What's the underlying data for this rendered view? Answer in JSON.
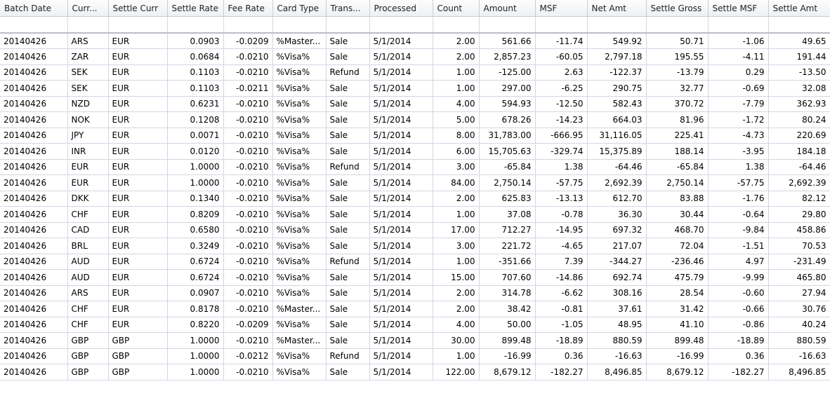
{
  "columns": [
    {
      "label": "Batch Date",
      "align": "txt"
    },
    {
      "label": "Curr...",
      "align": "txt"
    },
    {
      "label": "Settle Curr",
      "align": "txt"
    },
    {
      "label": "Settle Rate",
      "align": "num"
    },
    {
      "label": "Fee Rate",
      "align": "num"
    },
    {
      "label": "Card Type",
      "align": "txt"
    },
    {
      "label": "Trans...",
      "align": "txt"
    },
    {
      "label": "Processed",
      "align": "txt"
    },
    {
      "label": "Count",
      "align": "num"
    },
    {
      "label": "Amount",
      "align": "num"
    },
    {
      "label": "MSF",
      "align": "num"
    },
    {
      "label": "Net Amt",
      "align": "num"
    },
    {
      "label": "Settle Gross",
      "align": "num"
    },
    {
      "label": "Settle MSF",
      "align": "num"
    },
    {
      "label": "Settle Amt",
      "align": "num"
    }
  ],
  "rows": [
    [
      "20140426",
      "ARS",
      "EUR",
      "0.0903",
      "-0.0209",
      "%Master...",
      "Sale",
      "5/1/2014",
      "2.00",
      "561.66",
      "-11.74",
      "549.92",
      "50.71",
      "-1.06",
      "49.65"
    ],
    [
      "20140426",
      "ZAR",
      "EUR",
      "0.0684",
      "-0.0210",
      "%Visa%",
      "Sale",
      "5/1/2014",
      "2.00",
      "2,857.23",
      "-60.05",
      "2,797.18",
      "195.55",
      "-4.11",
      "191.44"
    ],
    [
      "20140426",
      "SEK",
      "EUR",
      "0.1103",
      "-0.0210",
      "%Visa%",
      "Refund",
      "5/1/2014",
      "1.00",
      "-125.00",
      "2.63",
      "-122.37",
      "-13.79",
      "0.29",
      "-13.50"
    ],
    [
      "20140426",
      "SEK",
      "EUR",
      "0.1103",
      "-0.0211",
      "%Visa%",
      "Sale",
      "5/1/2014",
      "1.00",
      "297.00",
      "-6.25",
      "290.75",
      "32.77",
      "-0.69",
      "32.08"
    ],
    [
      "20140426",
      "NZD",
      "EUR",
      "0.6231",
      "-0.0210",
      "%Visa%",
      "Sale",
      "5/1/2014",
      "4.00",
      "594.93",
      "-12.50",
      "582.43",
      "370.72",
      "-7.79",
      "362.93"
    ],
    [
      "20140426",
      "NOK",
      "EUR",
      "0.1208",
      "-0.0210",
      "%Visa%",
      "Sale",
      "5/1/2014",
      "5.00",
      "678.26",
      "-14.23",
      "664.03",
      "81.96",
      "-1.72",
      "80.24"
    ],
    [
      "20140426",
      "JPY",
      "EUR",
      "0.0071",
      "-0.0210",
      "%Visa%",
      "Sale",
      "5/1/2014",
      "8.00",
      "31,783.00",
      "-666.95",
      "31,116.05",
      "225.41",
      "-4.73",
      "220.69"
    ],
    [
      "20140426",
      "INR",
      "EUR",
      "0.0120",
      "-0.0210",
      "%Visa%",
      "Sale",
      "5/1/2014",
      "6.00",
      "15,705.63",
      "-329.74",
      "15,375.89",
      "188.14",
      "-3.95",
      "184.18"
    ],
    [
      "20140426",
      "EUR",
      "EUR",
      "1.0000",
      "-0.0210",
      "%Visa%",
      "Refund",
      "5/1/2014",
      "3.00",
      "-65.84",
      "1.38",
      "-64.46",
      "-65.84",
      "1.38",
      "-64.46"
    ],
    [
      "20140426",
      "EUR",
      "EUR",
      "1.0000",
      "-0.0210",
      "%Visa%",
      "Sale",
      "5/1/2014",
      "84.00",
      "2,750.14",
      "-57.75",
      "2,692.39",
      "2,750.14",
      "-57.75",
      "2,692.39"
    ],
    [
      "20140426",
      "DKK",
      "EUR",
      "0.1340",
      "-0.0210",
      "%Visa%",
      "Sale",
      "5/1/2014",
      "2.00",
      "625.83",
      "-13.13",
      "612.70",
      "83.88",
      "-1.76",
      "82.12"
    ],
    [
      "20140426",
      "CHF",
      "EUR",
      "0.8209",
      "-0.0210",
      "%Visa%",
      "Sale",
      "5/1/2014",
      "1.00",
      "37.08",
      "-0.78",
      "36.30",
      "30.44",
      "-0.64",
      "29.80"
    ],
    [
      "20140426",
      "CAD",
      "EUR",
      "0.6580",
      "-0.0210",
      "%Visa%",
      "Sale",
      "5/1/2014",
      "17.00",
      "712.27",
      "-14.95",
      "697.32",
      "468.70",
      "-9.84",
      "458.86"
    ],
    [
      "20140426",
      "BRL",
      "EUR",
      "0.3249",
      "-0.0210",
      "%Visa%",
      "Sale",
      "5/1/2014",
      "3.00",
      "221.72",
      "-4.65",
      "217.07",
      "72.04",
      "-1.51",
      "70.53"
    ],
    [
      "20140426",
      "AUD",
      "EUR",
      "0.6724",
      "-0.0210",
      "%Visa%",
      "Refund",
      "5/1/2014",
      "1.00",
      "-351.66",
      "7.39",
      "-344.27",
      "-236.46",
      "4.97",
      "-231.49"
    ],
    [
      "20140426",
      "AUD",
      "EUR",
      "0.6724",
      "-0.0210",
      "%Visa%",
      "Sale",
      "5/1/2014",
      "15.00",
      "707.60",
      "-14.86",
      "692.74",
      "475.79",
      "-9.99",
      "465.80"
    ],
    [
      "20140426",
      "ARS",
      "EUR",
      "0.0907",
      "-0.0210",
      "%Visa%",
      "Sale",
      "5/1/2014",
      "2.00",
      "314.78",
      "-6.62",
      "308.16",
      "28.54",
      "-0.60",
      "27.94"
    ],
    [
      "20140426",
      "CHF",
      "EUR",
      "0.8178",
      "-0.0210",
      "%Master...",
      "Sale",
      "5/1/2014",
      "2.00",
      "38.42",
      "-0.81",
      "37.61",
      "31.42",
      "-0.66",
      "30.76"
    ],
    [
      "20140426",
      "CHF",
      "EUR",
      "0.8220",
      "-0.0209",
      "%Visa%",
      "Sale",
      "5/1/2014",
      "4.00",
      "50.00",
      "-1.05",
      "48.95",
      "41.10",
      "-0.86",
      "40.24"
    ],
    [
      "20140426",
      "GBP",
      "GBP",
      "1.0000",
      "-0.0210",
      "%Master...",
      "Sale",
      "5/1/2014",
      "30.00",
      "899.48",
      "-18.89",
      "880.59",
      "899.48",
      "-18.89",
      "880.59"
    ],
    [
      "20140426",
      "GBP",
      "GBP",
      "1.0000",
      "-0.0212",
      "%Visa%",
      "Refund",
      "5/1/2014",
      "1.00",
      "-16.99",
      "0.36",
      "-16.63",
      "-16.99",
      "0.36",
      "-16.63"
    ],
    [
      "20140426",
      "GBP",
      "GBP",
      "1.0000",
      "-0.0210",
      "%Visa%",
      "Sale",
      "5/1/2014",
      "122.00",
      "8,679.12",
      "-182.27",
      "8,496.85",
      "8,679.12",
      "-182.27",
      "8,496.85"
    ]
  ]
}
